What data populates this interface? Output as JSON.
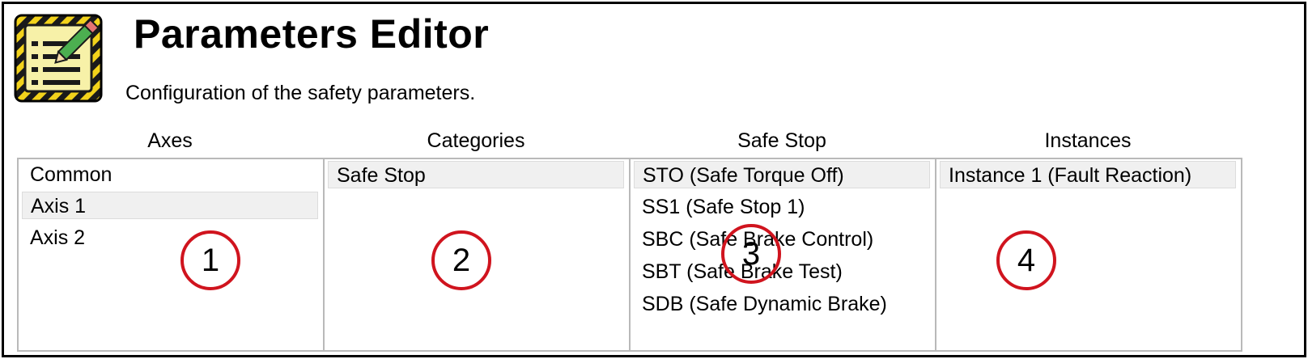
{
  "header": {
    "icon": "notepad-pencil-icon",
    "title": "Parameters Editor",
    "subtitle": "Configuration of the safety parameters."
  },
  "columns": [
    {
      "header": "Axes",
      "items": [
        "Common",
        "Axis 1",
        "Axis 2"
      ],
      "selected": "Axis 1"
    },
    {
      "header": "Categories",
      "items": [
        "Safe Stop"
      ],
      "selected": "Safe Stop"
    },
    {
      "header": "Safe Stop",
      "items": [
        "STO (Safe Torque Off)",
        "SS1 (Safe Stop 1)",
        "SBC (Safe Brake Control)",
        "SBT (Safe Brake Test)",
        "SDB (Safe Dynamic Brake)"
      ],
      "selected": "STO (Safe Torque Off)"
    },
    {
      "header": "Instances",
      "items": [
        "Instance 1 (Fault Reaction)"
      ],
      "selected": "Instance 1 (Fault Reaction)"
    }
  ],
  "callouts": [
    "1",
    "2",
    "3",
    "4"
  ],
  "colors": {
    "callout_ring": "#d0141e",
    "selection_bg": "#f0f0f0",
    "panel_border": "#b9b9b9",
    "icon_stripe": "#f2d21b"
  }
}
